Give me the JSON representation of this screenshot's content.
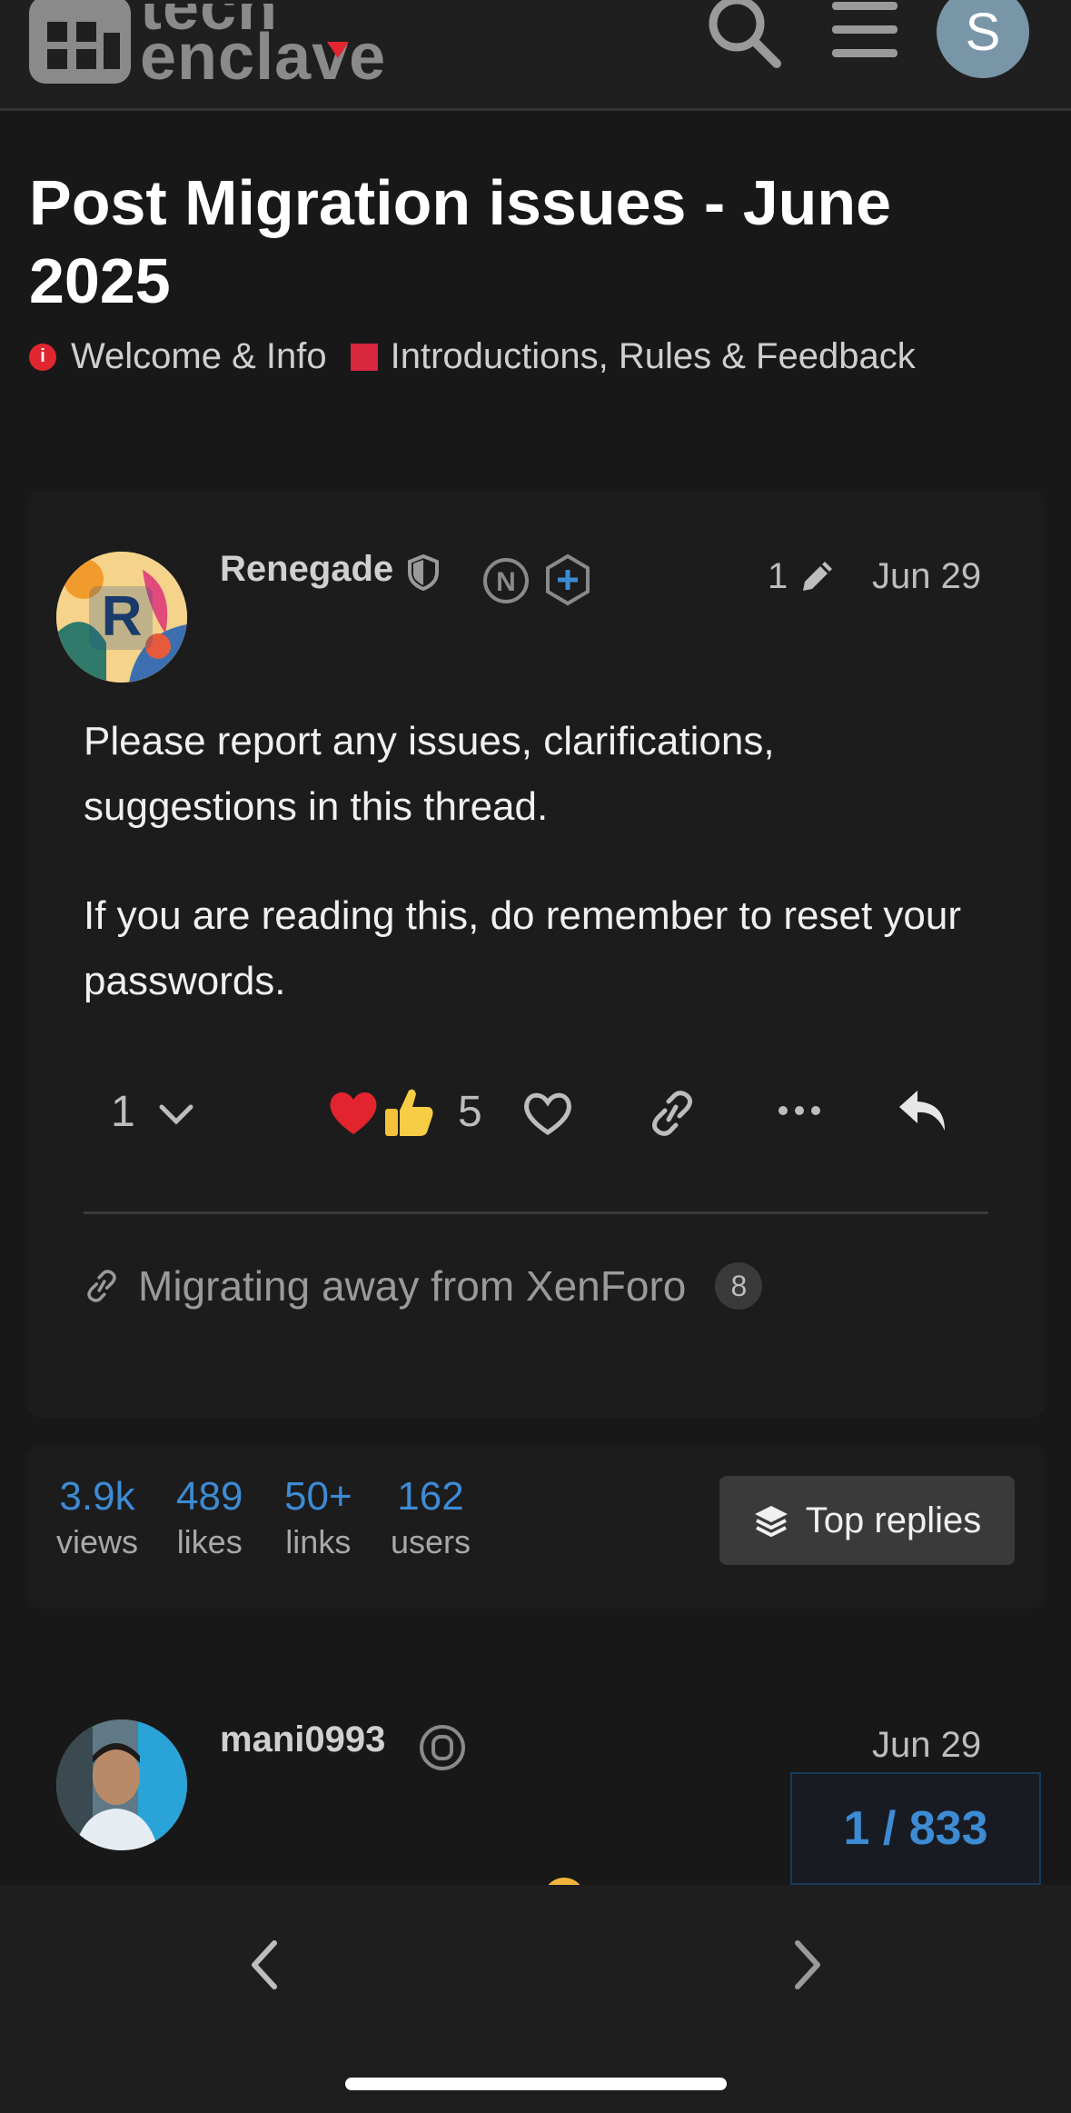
{
  "header": {
    "logo_line1": "tech",
    "logo_line2": "enclave",
    "avatar_letter": "S",
    "colors": {
      "accent": "#e0262f",
      "avatar_bg": "#7896a8"
    },
    "icons": [
      "search-icon",
      "hamburger-menu-icon"
    ]
  },
  "topic": {
    "title": "Post Migration issues - June 2025",
    "category": "Welcome & Info",
    "subcategory": "Introductions, Rules & Feedback"
  },
  "post": {
    "username": "Renegade",
    "avatar_letter": "R",
    "edit_count": "1",
    "date": "Jun 29",
    "paragraphs": [
      "Please report any issues, clarifications, suggestions in this thread.",
      "If you are reading this, do remember to reset your passwords."
    ],
    "reply_count": "1",
    "reaction_count": "5",
    "linked_topic": "Migrating away from XenForo",
    "linked_count": "8"
  },
  "stats": {
    "items": [
      {
        "value": "3.9k",
        "label": "views"
      },
      {
        "value": "489",
        "label": "likes"
      },
      {
        "value": "50+",
        "label": "links"
      },
      {
        "value": "162",
        "label": "users"
      }
    ],
    "top_replies_label": "Top replies"
  },
  "second_post": {
    "username": "mani0993",
    "date": "Jun 29"
  },
  "progress": {
    "label": "1 / 833"
  }
}
